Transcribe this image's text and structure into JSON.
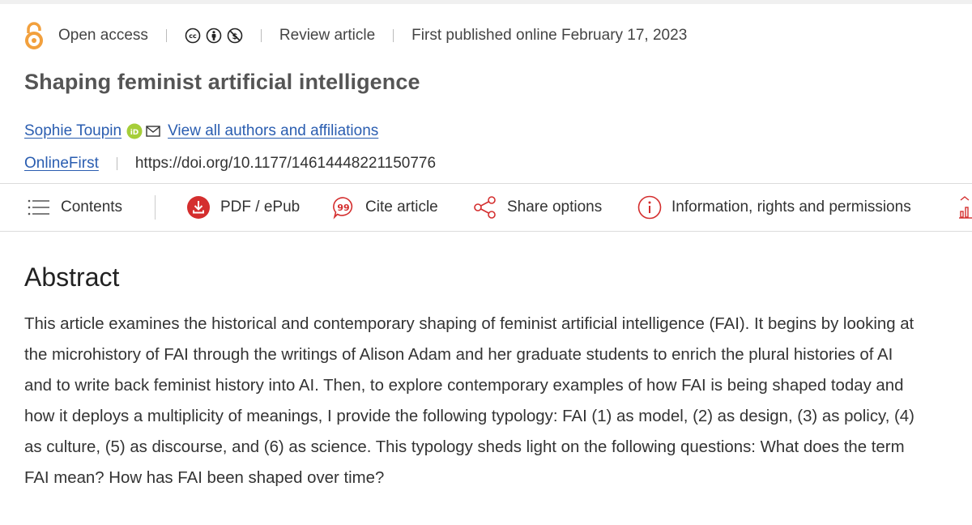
{
  "meta": {
    "access": "Open access",
    "license_icons": [
      "cc-icon",
      "attribution-icon",
      "noncommercial-icon"
    ],
    "article_type": "Review article",
    "published": "First published online February 17, 2023"
  },
  "article": {
    "title": "Shaping feminist artificial intelligence",
    "author": "Sophie Toupin",
    "view_all": "View all authors and affiliations",
    "status": "OnlineFirst",
    "doi": "https://doi.org/10.1177/14614448221150776"
  },
  "toolbar": {
    "contents": "Contents",
    "pdf": "PDF / ePub",
    "cite": "Cite article",
    "share": "Share options",
    "info": "Information, rights and permissions"
  },
  "abstract": {
    "heading": "Abstract",
    "text": "This article examines the historical and contemporary shaping of feminist artificial intelligence (FAI). It begins by looking at the microhistory of FAI through the writings of Alison Adam and her graduate students to enrich the plural histories of AI and to write back feminist history into AI. Then, to explore contemporary examples of how FAI is being shaped today and how it deploys a multiplicity of meanings, I provide the following typology: FAI (1) as model, (2) as design, (3) as policy, (4) as culture, (5) as discourse, and (6) as science. This typology sheds light on the following questions: What does the term FAI mean? How has FAI been shaped over time?"
  },
  "colors": {
    "accent_red": "#d42e2e",
    "link_blue": "#2a5db0",
    "open_access_orange": "#f2a03d",
    "orcid_green": "#a6ce39"
  }
}
